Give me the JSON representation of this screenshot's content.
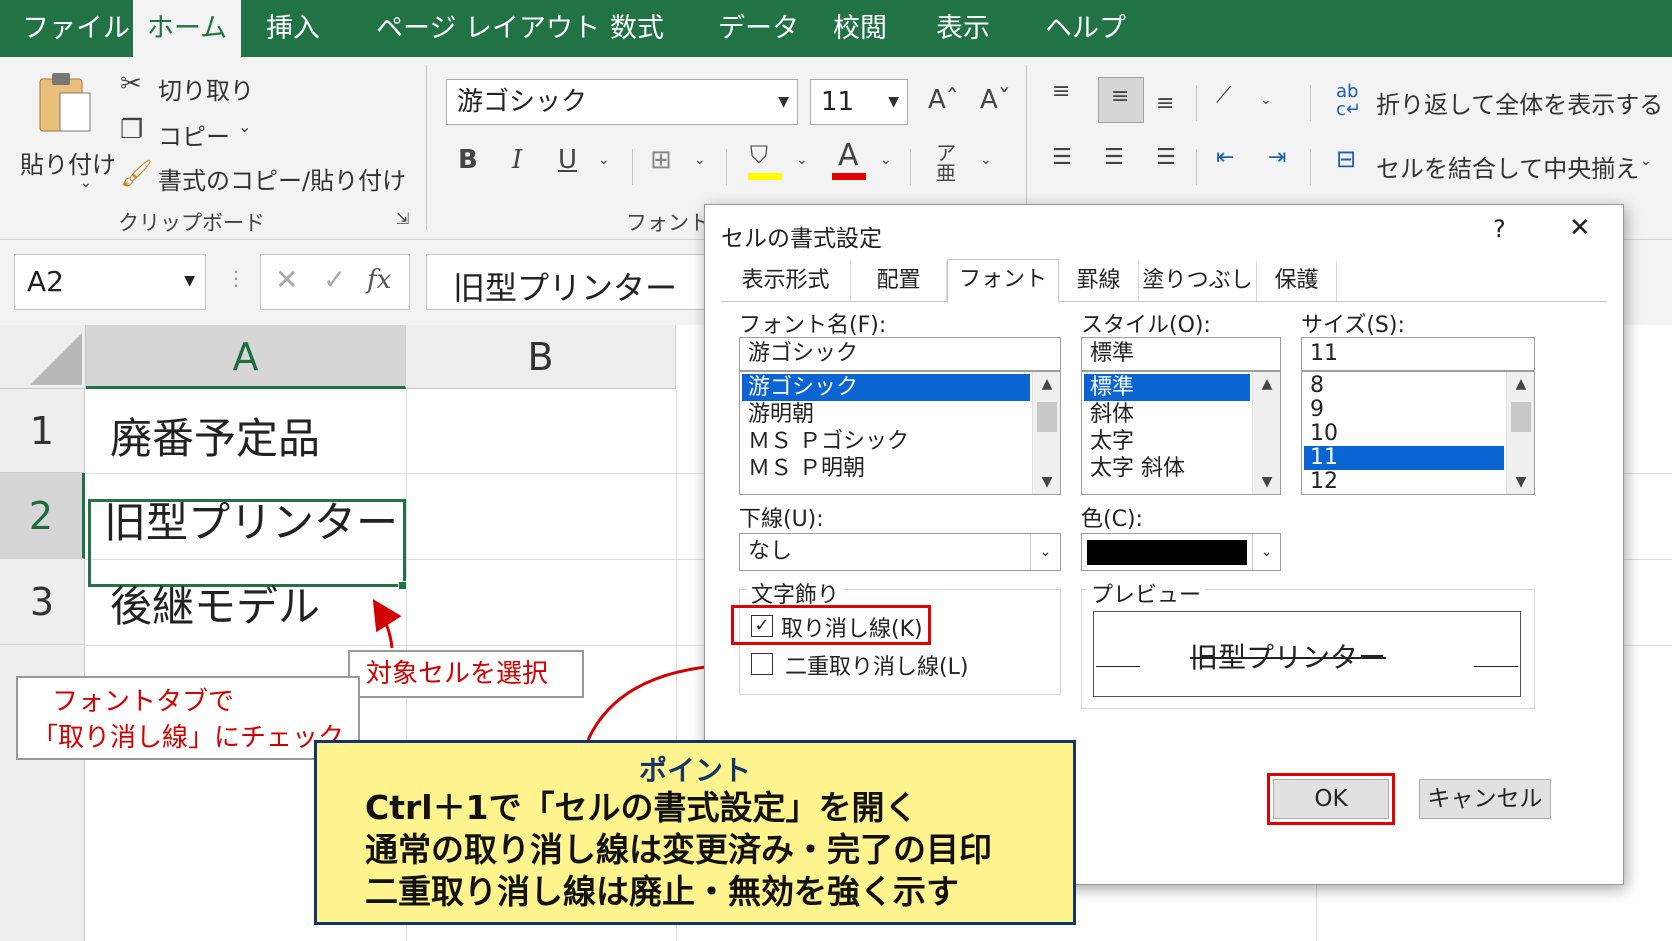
{
  "colors": {
    "excel_green": "#217346",
    "selection_blue": "#0a64d2",
    "annotation_red": "#d10000",
    "note_yellow": "#fff48e"
  },
  "tabs": [
    "ファイル",
    "ホーム",
    "挿入",
    "ページ レイアウト",
    "数式",
    "データ",
    "校閲",
    "表示",
    "ヘルプ"
  ],
  "active_tab": "ホーム",
  "ribbon": {
    "clipboard": {
      "paste": "貼り付け",
      "cut": "切り取り",
      "copy": "コピー",
      "format_painter": "書式のコピー/貼り付け",
      "group_label": "クリップボード"
    },
    "font": {
      "font_name": "游ゴシック",
      "font_size": "11",
      "bold": "B",
      "italic": "I",
      "underline": "U",
      "font_color_glyph": "A",
      "group_label": "フォント"
    },
    "alignment": {
      "wrap_text": "折り返して全体を表示する",
      "merge_center": "セルを結合して中央揃え"
    }
  },
  "formula_bar": {
    "name_box": "A2",
    "fx": "fx",
    "content": "旧型プリンター"
  },
  "grid": {
    "columns": [
      "A",
      "B"
    ],
    "rows": [
      {
        "num": "1",
        "a": "廃番予定品"
      },
      {
        "num": "2",
        "a": "旧型プリンター"
      },
      {
        "num": "3",
        "a": "後継モデル"
      }
    ]
  },
  "dialog": {
    "title": "セルの書式設定",
    "help": "?",
    "close": "✕",
    "tabs": [
      "表示形式",
      "配置",
      "フォント",
      "罫線",
      "塗りつぶし",
      "保護"
    ],
    "active_tab": "フォント",
    "font_name_label": "フォント名(F):",
    "font_name_value": "游ゴシック",
    "font_list": [
      "游ゴシック",
      "游明朝",
      "ＭＳ Ｐゴシック",
      "ＭＳ Ｐ明朝"
    ],
    "style_label": "スタイル(O):",
    "style_value": "標準",
    "style_list": [
      "標準",
      "斜体",
      "太字",
      "太字 斜体"
    ],
    "size_label": "サイズ(S):",
    "size_value": "11",
    "size_list": [
      "8",
      "9",
      "10",
      "11",
      "12"
    ],
    "underline_label": "下線(U):",
    "underline_value": "なし",
    "color_label": "色(C):",
    "effects_label": "文字飾り",
    "strikethrough_label": "取り消し線(K)",
    "strikethrough_checked": true,
    "double_strikethrough_label": "二重取り消し線(L)",
    "double_strikethrough_checked": false,
    "preview_label": "プレビュー",
    "preview_text": "旧型プリンター",
    "ok": "OK",
    "cancel": "キャンセル"
  },
  "annotations": {
    "select_cell": "対象セルを選択",
    "font_tab_line1": "フォントタブで",
    "font_tab_line2": "「取り消し線」にチェック",
    "point_title": "ポイント",
    "point_lines": [
      "Ctrl＋1で「セルの書式設定」を開く",
      "通常の取り消し線は変更済み・完了の目印",
      "二重取り消し線は廃止・無効を強く示す"
    ]
  }
}
